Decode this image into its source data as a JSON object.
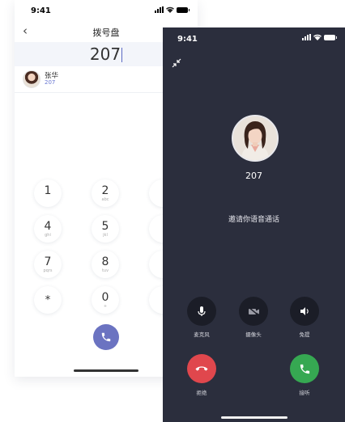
{
  "colors": {
    "accent": "#6b73c1",
    "reject": "#e0474d",
    "accept": "#36a852",
    "call_bg": "#2b2e3d"
  },
  "back_phone": {
    "status_time": "9:41",
    "nav": {
      "title": "拨号盘"
    },
    "dial_value": "207",
    "contact": {
      "name": "张华",
      "number": "207"
    },
    "keys": [
      {
        "digit": "1",
        "letters": ""
      },
      {
        "digit": "2",
        "letters": "abc"
      },
      {
        "digit": "4",
        "letters": "ghi"
      },
      {
        "digit": "5",
        "letters": "jkl"
      },
      {
        "digit": "7",
        "letters": "pqrs"
      },
      {
        "digit": "8",
        "letters": "tuv"
      },
      {
        "digit": "*",
        "letters": ""
      },
      {
        "digit": "0",
        "letters": "+"
      }
    ]
  },
  "front_phone": {
    "status_time": "9:41",
    "caller_number": "207",
    "invite_text": "邀请你语音通话",
    "controls": {
      "mic": "麦克风",
      "camera": "摄像头",
      "speaker": "免提"
    },
    "reject_label": "拒绝",
    "accept_label": "接听"
  }
}
